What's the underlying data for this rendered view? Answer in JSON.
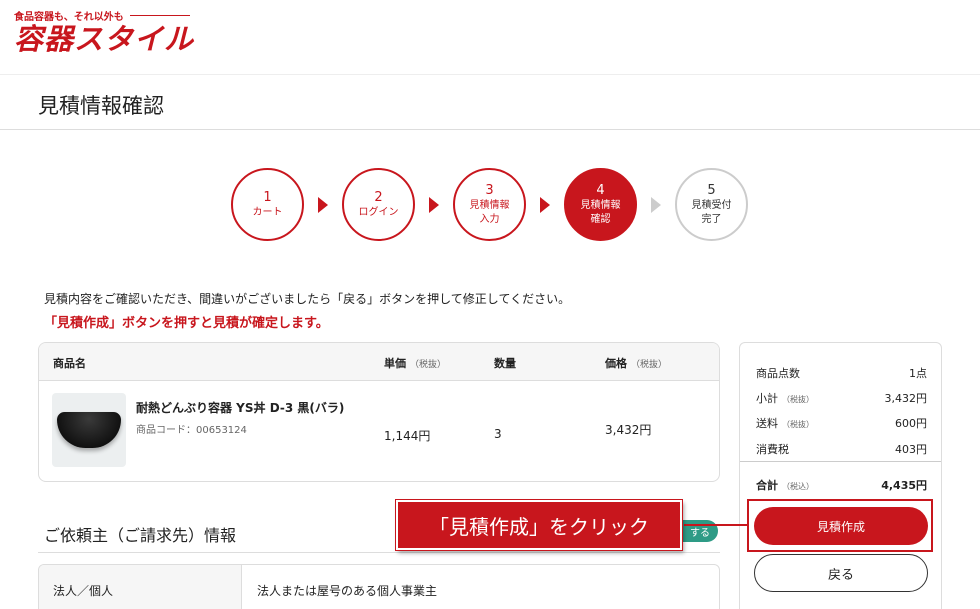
{
  "header": {
    "logo_tagline": "食品容器も、それ以外も",
    "logo_text": "容器スタイル"
  },
  "page_title": "見積情報確認",
  "steps": [
    {
      "num": "1",
      "label1": "カート",
      "label2": ""
    },
    {
      "num": "2",
      "label1": "ログイン",
      "label2": ""
    },
    {
      "num": "3",
      "label1": "見積情報",
      "label2": "入力"
    },
    {
      "num": "4",
      "label1": "見積情報",
      "label2": "確認"
    },
    {
      "num": "5",
      "label1": "見積受付",
      "label2": "完了"
    }
  ],
  "notice": {
    "text": "見積内容をご確認いただき、間違いがございましたら「戻る」ボタンを押して修正してください。",
    "warning": "「見積作成」ボタンを押すと見積が確定します。"
  },
  "product_table": {
    "headers": {
      "name": "商品名",
      "unit_price": "単価",
      "unit_price_note": "（税抜）",
      "quantity": "数量",
      "price": "価格",
      "price_note": "（税抜）"
    },
    "rows": [
      {
        "name": "耐熱どんぶり容器 YS丼 D-3 黒(バラ)",
        "code": "商品コード：00653124",
        "unit_price": "1,144円",
        "quantity": "3",
        "price": "3,432円"
      }
    ]
  },
  "requester": {
    "title": "ご依頼主（ご請求先）情報",
    "badge": "する",
    "rows": [
      {
        "label": "法人／個人",
        "value": "法人または屋号のある個人事業主"
      }
    ]
  },
  "summary": {
    "count_label": "商品点数",
    "count_value": "1点",
    "subtotal_label": "小計",
    "subtotal_note": "（税抜）",
    "subtotal_value": "3,432円",
    "shipping_label": "送料",
    "shipping_note": "（税抜）",
    "shipping_value": "600円",
    "tax_label": "消費税",
    "tax_value": "403円",
    "total_label": "合計",
    "total_note": "（税込）",
    "total_value": "4,435円"
  },
  "buttons": {
    "create": "見積作成",
    "back": "戻る"
  },
  "callout": "「見積作成」をクリック",
  "colors": {
    "brand_red": "#c8161d",
    "badge_green": "#2e9b86"
  }
}
